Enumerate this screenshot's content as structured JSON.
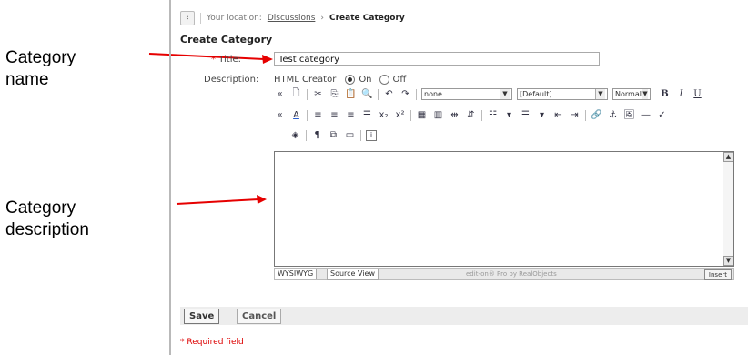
{
  "annotations": {
    "category_name": [
      "Category",
      "name"
    ],
    "category_description": [
      "Category",
      "description"
    ],
    "arrow_color": "#e60000"
  },
  "breadcrumb": {
    "prefix": "Your location:",
    "link": "Discussions",
    "separator": "›",
    "current": "Create Category"
  },
  "form": {
    "heading": "Create Category",
    "title_label": "Title:",
    "title_required_mark": "*",
    "title_value": "Test category",
    "description_label": "Description:",
    "html_creator_label": "HTML Creator",
    "mode_on": "On",
    "mode_off": "Off",
    "mode_selected": "On"
  },
  "editor": {
    "font_select": "none",
    "size_select": "[Default]",
    "style_select": "Normal",
    "tab_wysiwyg": "WYSIWYG",
    "tab_source": "Source View",
    "credit": "edit-on® Pro by RealObjects",
    "insert_button": "Insert"
  },
  "actions": {
    "save": "Save",
    "cancel": "Cancel"
  },
  "required_note": "* Required field"
}
